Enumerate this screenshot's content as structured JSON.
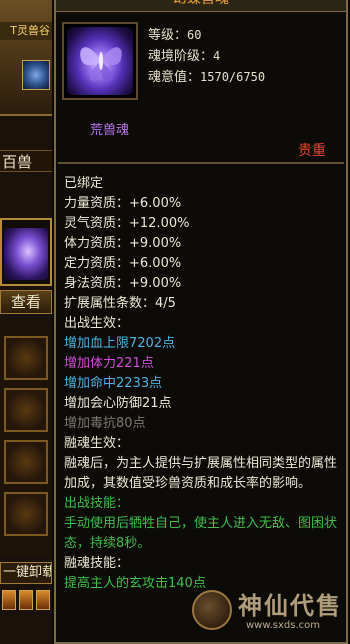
{
  "left_panel": {
    "top_title": "T灵兽谷",
    "category_label": "百兽",
    "view_button": "查看",
    "one_key_button": "一键卸载"
  },
  "tooltip": {
    "title": "幻蝶兽魂",
    "stats": [
      {
        "label": "等级：",
        "value": "60"
      },
      {
        "label": "魂境阶级：",
        "value": "4"
      },
      {
        "label": "魂意值：",
        "value": "1570/6750"
      }
    ],
    "type": "荒兽魂",
    "rarity": "贵重",
    "bound": "已绑定",
    "aptitudes": [
      "力量资质：+6.00%",
      "灵气资质：+12.00%",
      "体力资质：+9.00%",
      "定力资质：+6.00%",
      "身法资质：+9.00%",
      "扩展属性条数：4/5"
    ],
    "battle_effect_title": "出战生效：",
    "battle_effects": [
      {
        "text": "增加血上限7202点",
        "color": "blue"
      },
      {
        "text": "增加体力221点",
        "color": "purple"
      },
      {
        "text": "增加命中2233点",
        "color": "blue"
      },
      {
        "text": "增加会心防御21点",
        "color": "white"
      },
      {
        "text": "增加毒抗80点",
        "color": "gray"
      }
    ],
    "fusion_effect_title": "融魂生效：",
    "fusion_effect_desc": "融魂后，为主人提供与扩展属性相同类型的属性加成，其数值受珍兽资质和成长率的影响。",
    "battle_skill_title": "出战技能：",
    "battle_skill_desc": "手动使用后牺牲自己，使主人进入无敌、图困状态，持续8秒。",
    "fusion_skill_title": "融魂技能：",
    "fusion_skill_desc": "提高主人的玄攻击140点"
  },
  "watermark": {
    "text": "神仙代售",
    "url": "www.sxds.com"
  }
}
